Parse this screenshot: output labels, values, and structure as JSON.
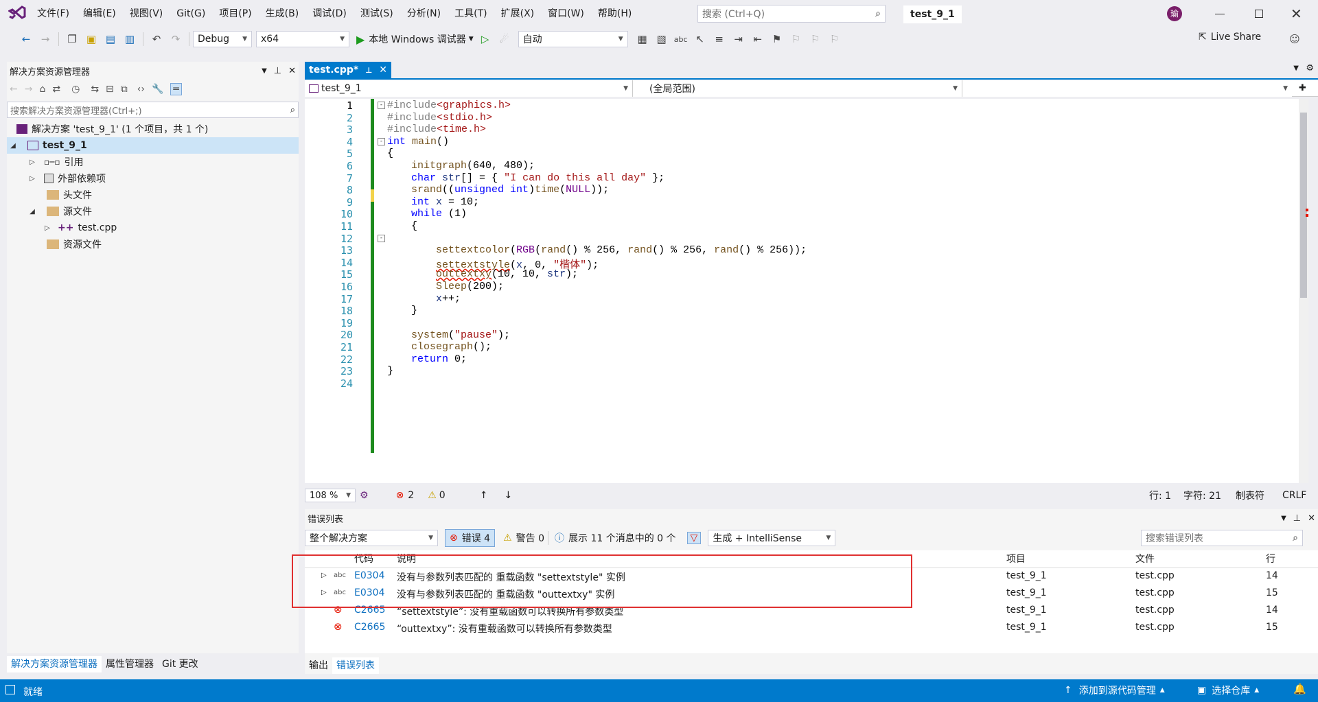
{
  "menu": {
    "items": [
      "文件(F)",
      "编辑(E)",
      "视图(V)",
      "Git(G)",
      "项目(P)",
      "生成(B)",
      "调试(D)",
      "测试(S)",
      "分析(N)",
      "工具(T)",
      "扩展(X)",
      "窗口(W)",
      "帮助(H)"
    ],
    "search_placeholder": "搜索 (Ctrl+Q)",
    "solution_name": "test_9_1",
    "avatar_letter": "瑜"
  },
  "toolbar": {
    "config": "Debug",
    "platform": "x64",
    "run_label": "本地 Windows 调试器",
    "auto_label": "自动",
    "live_share": "Live Share"
  },
  "solution_explorer": {
    "title": "解决方案资源管理器",
    "search_placeholder": "搜索解决方案资源管理器(Ctrl+;)",
    "solution_label": "解决方案 'test_9_1' (1 个项目，共 1 个)",
    "project": "test_9_1",
    "nodes": {
      "refs": "引用",
      "external": "外部依赖项",
      "headers": "头文件",
      "sources": "源文件",
      "file": "test.cpp",
      "resources": "资源文件"
    },
    "bottom_tabs": [
      "解决方案资源管理器",
      "属性管理器",
      "Git 更改"
    ]
  },
  "editor": {
    "tab_name": "test.cpp*",
    "nav_project": "test_9_1",
    "nav_scope": "(全局范围)",
    "line_numbers": [
      "1",
      "2",
      "3",
      "4",
      "5",
      "6",
      "7",
      "8",
      "9",
      "10",
      "11",
      "12",
      "13",
      "14",
      "15",
      "16",
      "17",
      "18",
      "19",
      "20",
      "21",
      "22",
      "23",
      "24"
    ],
    "zoom": "108 %",
    "errors_count": "2",
    "warnings_count": "0",
    "status_line": "行: 1",
    "status_col": "字符: 21",
    "status_tab": "制表符",
    "status_eol": "CRLF"
  },
  "error_list": {
    "title": "错误列表",
    "scope": "整个解决方案",
    "errors_btn": "错误 4",
    "warnings_btn": "警告 0",
    "messages_btn": "展示 11 个消息中的 0 个",
    "build_filter": "生成 + IntelliSense",
    "search_placeholder": "搜索错误列表",
    "headers": {
      "code": "代码",
      "desc": "说明",
      "project": "项目",
      "file": "文件",
      "line": "行"
    },
    "rows": [
      {
        "code": "E0304",
        "desc": "没有与参数列表匹配的 重载函数 \"settextstyle\" 实例",
        "project": "test_9_1",
        "file": "test.cpp",
        "line": "14"
      },
      {
        "code": "E0304",
        "desc": "没有与参数列表匹配的 重载函数 \"outtextxy\" 实例",
        "project": "test_9_1",
        "file": "test.cpp",
        "line": "15"
      },
      {
        "code": "C2665",
        "desc": "“settextstyle”: 没有重载函数可以转换所有参数类型",
        "project": "test_9_1",
        "file": "test.cpp",
        "line": "14"
      },
      {
        "code": "C2665",
        "desc": "“outtextxy”: 没有重载函数可以转换所有参数类型",
        "project": "test_9_1",
        "file": "test.cpp",
        "line": "15"
      }
    ],
    "bottom_tabs": [
      "输出",
      "错误列表"
    ]
  },
  "statusbar": {
    "ready": "就绪",
    "add_source": "添加到源代码管理",
    "select_repo": "选择仓库"
  },
  "colors": {
    "accent": "#007acc",
    "vs_purple": "#68217a",
    "error_red": "#e51400",
    "highlight_box": "#e03030"
  }
}
